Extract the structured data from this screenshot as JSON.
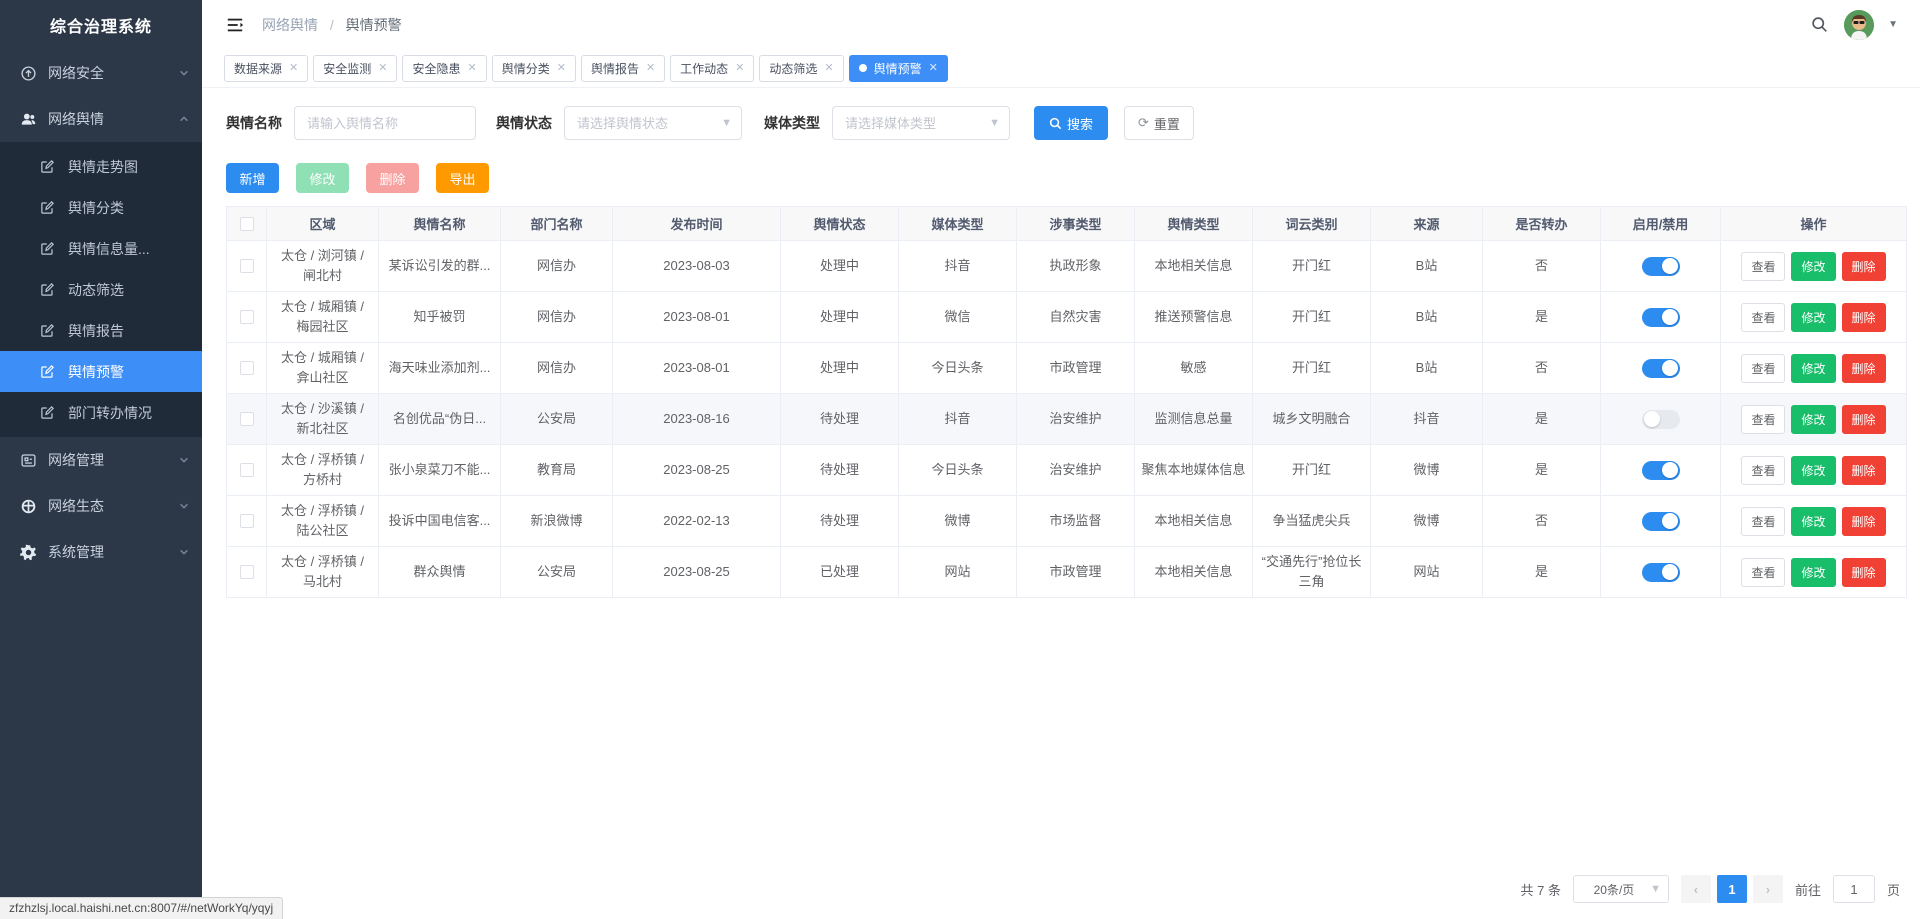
{
  "sidebar": {
    "title": "综合治理系统",
    "menu": [
      {
        "key": "network-security",
        "label": "网络安全",
        "icon": "network-security-icon",
        "chevron": "down",
        "active": false
      },
      {
        "key": "network-yuqing",
        "label": "网络舆情",
        "icon": "users-icon",
        "chevron": "up",
        "active": true,
        "children": [
          {
            "key": "yuqing-trend",
            "label": "舆情走势图",
            "active": false
          },
          {
            "key": "yuqing-category",
            "label": "舆情分类",
            "active": false
          },
          {
            "key": "yuqing-info-volume",
            "label": "舆情信息量...",
            "active": false
          },
          {
            "key": "dynamic-filter",
            "label": "动态筛选",
            "active": false
          },
          {
            "key": "yuqing-report",
            "label": "舆情报告",
            "active": false
          },
          {
            "key": "yuqing-warning",
            "label": "舆情预警",
            "active": true
          },
          {
            "key": "department-transfer",
            "label": "部门转办情况",
            "active": false
          }
        ]
      },
      {
        "key": "network-manage",
        "label": "网络管理",
        "icon": "monitor-icon",
        "chevron": "down",
        "active": false
      },
      {
        "key": "network-eco",
        "label": "网络生态",
        "icon": "globe-icon",
        "chevron": "down",
        "active": false
      },
      {
        "key": "system-manage",
        "label": "系统管理",
        "icon": "gear-icon",
        "chevron": "down",
        "active": false
      }
    ]
  },
  "header": {
    "breadcrumb": [
      "网络舆情",
      "舆情预警"
    ],
    "breadcrumb_separator": "/"
  },
  "tabbar": {
    "tabs": [
      {
        "key": "data-source",
        "label": "数据来源",
        "active": false
      },
      {
        "key": "security-monitor",
        "label": "安全监测",
        "active": false
      },
      {
        "key": "security-risk",
        "label": "安全隐患",
        "active": false
      },
      {
        "key": "yuqing-category",
        "label": "舆情分类",
        "active": false
      },
      {
        "key": "yuqing-report",
        "label": "舆情报告",
        "active": false
      },
      {
        "key": "work-dynamic",
        "label": "工作动态",
        "active": false
      },
      {
        "key": "dynamic-filter",
        "label": "动态筛选",
        "active": false
      },
      {
        "key": "yuqing-warning",
        "label": "舆情预警",
        "active": true
      }
    ]
  },
  "filters": {
    "name_label": "舆情名称",
    "name_placeholder": "请输入舆情名称",
    "status_label": "舆情状态",
    "status_placeholder": "请选择舆情状态",
    "media_label": "媒体类型",
    "media_placeholder": "请选择媒体类型",
    "search_label": "搜索",
    "reset_label": "重置"
  },
  "toolbar": {
    "add_label": "新增",
    "edit_label": "修改",
    "delete_label": "删除",
    "export_label": "导出"
  },
  "table": {
    "columns": [
      "区域",
      "舆情名称",
      "部门名称",
      "发布时间",
      "舆情状态",
      "媒体类型",
      "涉事类型",
      "舆情类型",
      "词云类别",
      "来源",
      "是否转办",
      "启用/禁用",
      "操作"
    ],
    "action_labels": {
      "view": "查看",
      "edit": "修改",
      "delete": "删除"
    },
    "rows": [
      {
        "region": "太仓 / 浏河镇 / 闸北村",
        "name": "某诉讼引发的群...",
        "department": "网信办",
        "publish_time": "2023-08-03",
        "status": "处理中",
        "media": "抖音",
        "involved_type": "执政形象",
        "yuqing_type": "本地相关信息",
        "wordcloud": "开门红",
        "source": "B站",
        "transferred": "否",
        "enabled": true,
        "highlighted": false
      },
      {
        "region": "太仓 / 城厢镇 / 梅园社区",
        "name": "知乎被罚",
        "department": "网信办",
        "publish_time": "2023-08-01",
        "status": "处理中",
        "media": "微信",
        "involved_type": "自然灾害",
        "yuqing_type": "推送预警信息",
        "wordcloud": "开门红",
        "source": "B站",
        "transferred": "是",
        "enabled": true,
        "highlighted": false
      },
      {
        "region": "太仓 / 城厢镇 / 弇山社区",
        "name": "海天味业添加剂...",
        "department": "网信办",
        "publish_time": "2023-08-01",
        "status": "处理中",
        "media": "今日头条",
        "involved_type": "市政管理",
        "yuqing_type": "敏感",
        "wordcloud": "开门红",
        "source": "B站",
        "transferred": "否",
        "enabled": true,
        "highlighted": false
      },
      {
        "region": "太仓 / 沙溪镇 / 新北社区",
        "name": "名创优品“伪日...",
        "department": "公安局",
        "publish_time": "2023-08-16",
        "status": "待处理",
        "media": "抖音",
        "involved_type": "治安维护",
        "yuqing_type": "监测信息总量",
        "wordcloud": "城乡文明融合",
        "source": "抖音",
        "transferred": "是",
        "enabled": false,
        "highlighted": true
      },
      {
        "region": "太仓 / 浮桥镇 / 方桥村",
        "name": "张小泉菜刀不能...",
        "department": "教育局",
        "publish_time": "2023-08-25",
        "status": "待处理",
        "media": "今日头条",
        "involved_type": "治安维护",
        "yuqing_type": "聚焦本地媒体信息",
        "wordcloud": "开门红",
        "source": "微博",
        "transferred": "是",
        "enabled": true,
        "highlighted": false
      },
      {
        "region": "太仓 / 浮桥镇 / 陆公社区",
        "name": "投诉中国电信客...",
        "department": "新浪微博",
        "publish_time": "2022-02-13",
        "status": "待处理",
        "media": "微博",
        "involved_type": "市场监督",
        "yuqing_type": "本地相关信息",
        "wordcloud": "争当猛虎尖兵",
        "source": "微博",
        "transferred": "否",
        "enabled": true,
        "highlighted": false
      },
      {
        "region": "太仓 / 浮桥镇 / 马北村",
        "name": "群众舆情",
        "department": "公安局",
        "publish_time": "2023-08-25",
        "status": "已处理",
        "media": "网站",
        "involved_type": "市政管理",
        "yuqing_type": "本地相关信息",
        "wordcloud": "“交通先行”抢位长三角",
        "source": "网站",
        "transferred": "是",
        "enabled": true,
        "highlighted": false
      }
    ]
  },
  "pagination": {
    "total_label": "共 7 条",
    "page_size_label": "20条/页",
    "prev_label": "‹",
    "next_label": "›",
    "current_page": "1",
    "goto_label": "前往",
    "goto_value": "1",
    "page_unit_label": "页"
  },
  "statusbar": {
    "url": "zfzhzlsj.local.haishi.net.cn:8007/#/netWorkYq/yqyj"
  },
  "colors": {
    "sidebar_bg": "#2c3848",
    "submenu_bg": "#202b3a",
    "active_blue": "#3e8ef7",
    "primary_blue": "#2d8cf0",
    "action_green": "#19be6b",
    "action_red": "#f04134",
    "export_amber": "#ff9900",
    "toggle_off": "#e6eaef",
    "avatar_green": "#579a5b"
  }
}
